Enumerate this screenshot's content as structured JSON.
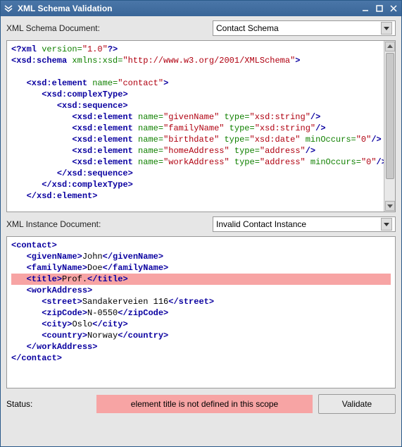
{
  "window": {
    "title": "XML Schema Validation"
  },
  "schema": {
    "label": "XML Schema Document:",
    "combo_value": "Contact Schema",
    "code_lines": [
      {
        "indent": 0,
        "parts": [
          {
            "cls": "tag",
            "t": "<?xml"
          },
          {
            "cls": "attrname",
            "t": " version="
          },
          {
            "cls": "attrval",
            "t": "\"1.0\""
          },
          {
            "cls": "tag",
            "t": "?>"
          }
        ]
      },
      {
        "indent": 0,
        "parts": [
          {
            "cls": "tag",
            "t": "<xsd:schema"
          },
          {
            "cls": "attrname",
            "t": " xmlns:xsd="
          },
          {
            "cls": "attrval",
            "t": "\"http://www.w3.org/2001/XMLSchema\""
          },
          {
            "cls": "tag",
            "t": ">"
          }
        ]
      },
      {
        "indent": 0,
        "parts": [
          {
            "cls": "txt",
            "t": " "
          }
        ]
      },
      {
        "indent": 1,
        "parts": [
          {
            "cls": "tag",
            "t": "<xsd:element"
          },
          {
            "cls": "attrname",
            "t": " name="
          },
          {
            "cls": "attrval",
            "t": "\"contact\""
          },
          {
            "cls": "tag",
            "t": ">"
          }
        ]
      },
      {
        "indent": 2,
        "parts": [
          {
            "cls": "tag",
            "t": "<xsd:complexType>"
          }
        ]
      },
      {
        "indent": 3,
        "parts": [
          {
            "cls": "tag",
            "t": "<xsd:sequence>"
          }
        ]
      },
      {
        "indent": 4,
        "parts": [
          {
            "cls": "tag",
            "t": "<xsd:element"
          },
          {
            "cls": "attrname",
            "t": " name="
          },
          {
            "cls": "attrval",
            "t": "\"givenName\""
          },
          {
            "cls": "attrname",
            "t": " type="
          },
          {
            "cls": "attrval",
            "t": "\"xsd:string\""
          },
          {
            "cls": "tag",
            "t": "/>"
          }
        ]
      },
      {
        "indent": 4,
        "parts": [
          {
            "cls": "tag",
            "t": "<xsd:element"
          },
          {
            "cls": "attrname",
            "t": " name="
          },
          {
            "cls": "attrval",
            "t": "\"familyName\""
          },
          {
            "cls": "attrname",
            "t": " type="
          },
          {
            "cls": "attrval",
            "t": "\"xsd:string\""
          },
          {
            "cls": "tag",
            "t": "/>"
          }
        ]
      },
      {
        "indent": 4,
        "parts": [
          {
            "cls": "tag",
            "t": "<xsd:element"
          },
          {
            "cls": "attrname",
            "t": " name="
          },
          {
            "cls": "attrval",
            "t": "\"birthdate\""
          },
          {
            "cls": "attrname",
            "t": " type="
          },
          {
            "cls": "attrval",
            "t": "\"xsd:date\""
          },
          {
            "cls": "attrname",
            "t": " minOccurs="
          },
          {
            "cls": "attrval",
            "t": "\"0\""
          },
          {
            "cls": "tag",
            "t": "/>"
          }
        ]
      },
      {
        "indent": 4,
        "parts": [
          {
            "cls": "tag",
            "t": "<xsd:element"
          },
          {
            "cls": "attrname",
            "t": " name="
          },
          {
            "cls": "attrval",
            "t": "\"homeAddress\""
          },
          {
            "cls": "attrname",
            "t": " type="
          },
          {
            "cls": "attrval",
            "t": "\"address\""
          },
          {
            "cls": "tag",
            "t": "/>"
          }
        ]
      },
      {
        "indent": 4,
        "parts": [
          {
            "cls": "tag",
            "t": "<xsd:element"
          },
          {
            "cls": "attrname",
            "t": " name="
          },
          {
            "cls": "attrval",
            "t": "\"workAddress\""
          },
          {
            "cls": "attrname",
            "t": " type="
          },
          {
            "cls": "attrval",
            "t": "\"address\""
          },
          {
            "cls": "attrname",
            "t": " minOccurs="
          },
          {
            "cls": "attrval",
            "t": "\"0\""
          },
          {
            "cls": "tag",
            "t": "/>"
          }
        ]
      },
      {
        "indent": 3,
        "parts": [
          {
            "cls": "tag",
            "t": "</xsd:sequence>"
          }
        ]
      },
      {
        "indent": 2,
        "parts": [
          {
            "cls": "tag",
            "t": "</xsd:complexType>"
          }
        ]
      },
      {
        "indent": 1,
        "parts": [
          {
            "cls": "tag",
            "t": "</xsd:element>"
          }
        ]
      }
    ]
  },
  "instance": {
    "label": "XML Instance Document:",
    "combo_value": "Invalid Contact Instance",
    "code_lines": [
      {
        "indent": 0,
        "parts": [
          {
            "cls": "tag",
            "t": "<contact>"
          }
        ]
      },
      {
        "indent": 1,
        "parts": [
          {
            "cls": "tag",
            "t": "<givenName>"
          },
          {
            "cls": "txt",
            "t": "John"
          },
          {
            "cls": "tag",
            "t": "</givenName>"
          }
        ]
      },
      {
        "indent": 1,
        "parts": [
          {
            "cls": "tag",
            "t": "<familyName>"
          },
          {
            "cls": "txt",
            "t": "Doe"
          },
          {
            "cls": "tag",
            "t": "</familyName>"
          }
        ]
      },
      {
        "indent": 1,
        "error": true,
        "parts": [
          {
            "cls": "tag",
            "t": "<title>"
          },
          {
            "cls": "txt",
            "t": "Prof."
          },
          {
            "cls": "tag",
            "t": "</title>"
          }
        ]
      },
      {
        "indent": 1,
        "parts": [
          {
            "cls": "tag",
            "t": "<workAddress>"
          }
        ]
      },
      {
        "indent": 2,
        "parts": [
          {
            "cls": "tag",
            "t": "<street>"
          },
          {
            "cls": "txt",
            "t": "Sandakerveien 116"
          },
          {
            "cls": "tag",
            "t": "</street>"
          }
        ]
      },
      {
        "indent": 2,
        "parts": [
          {
            "cls": "tag",
            "t": "<zipCode>"
          },
          {
            "cls": "txt",
            "t": "N-0550"
          },
          {
            "cls": "tag",
            "t": "</zipCode>"
          }
        ]
      },
      {
        "indent": 2,
        "parts": [
          {
            "cls": "tag",
            "t": "<city>"
          },
          {
            "cls": "txt",
            "t": "Oslo"
          },
          {
            "cls": "tag",
            "t": "</city>"
          }
        ]
      },
      {
        "indent": 2,
        "parts": [
          {
            "cls": "tag",
            "t": "<country>"
          },
          {
            "cls": "txt",
            "t": "Norway"
          },
          {
            "cls": "tag",
            "t": "</country>"
          }
        ]
      },
      {
        "indent": 1,
        "parts": [
          {
            "cls": "tag",
            "t": "</workAddress>"
          }
        ]
      },
      {
        "indent": 0,
        "parts": [
          {
            "cls": "tag",
            "t": "</contact>"
          }
        ]
      }
    ]
  },
  "status": {
    "label": "Status:",
    "message": "element title is not defined in this scope",
    "validate_label": "Validate"
  }
}
